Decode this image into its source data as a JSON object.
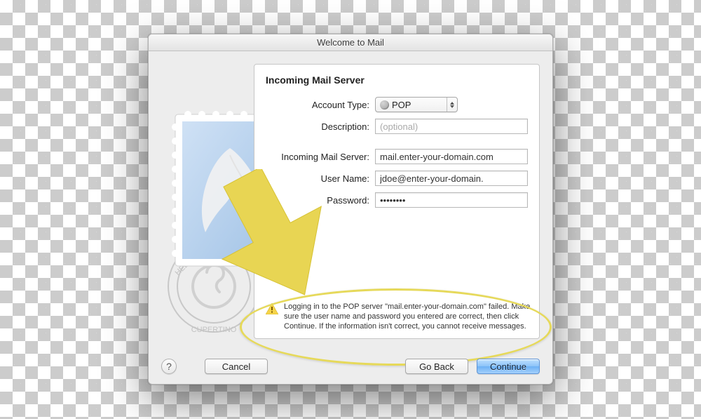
{
  "window": {
    "title": "Welcome to Mail"
  },
  "panel": {
    "title": "Incoming Mail Server"
  },
  "form": {
    "account_type_label": "Account Type:",
    "account_type_value": "POP",
    "description_label": "Description:",
    "description_placeholder": "(optional)",
    "description_value": "",
    "incoming_server_label": "Incoming Mail Server:",
    "incoming_server_value": "mail.enter-your-domain.com",
    "username_label": "User Name:",
    "username_value": "jdoe@enter-your-domain.",
    "password_label": "Password:",
    "password_value": "••••••••"
  },
  "error": {
    "message": "Logging in to the POP server \"mail.enter-your-domain.com\" failed. Make sure the user name and password you entered are correct, then click Continue. If the information isn't correct, you cannot receive messages."
  },
  "footer": {
    "help_label": "?",
    "cancel_label": "Cancel",
    "goback_label": "Go Back",
    "continue_label": "Continue"
  },
  "annotations": {
    "arrow_color": "#e8d553",
    "oval_color": "#e6d95a"
  }
}
